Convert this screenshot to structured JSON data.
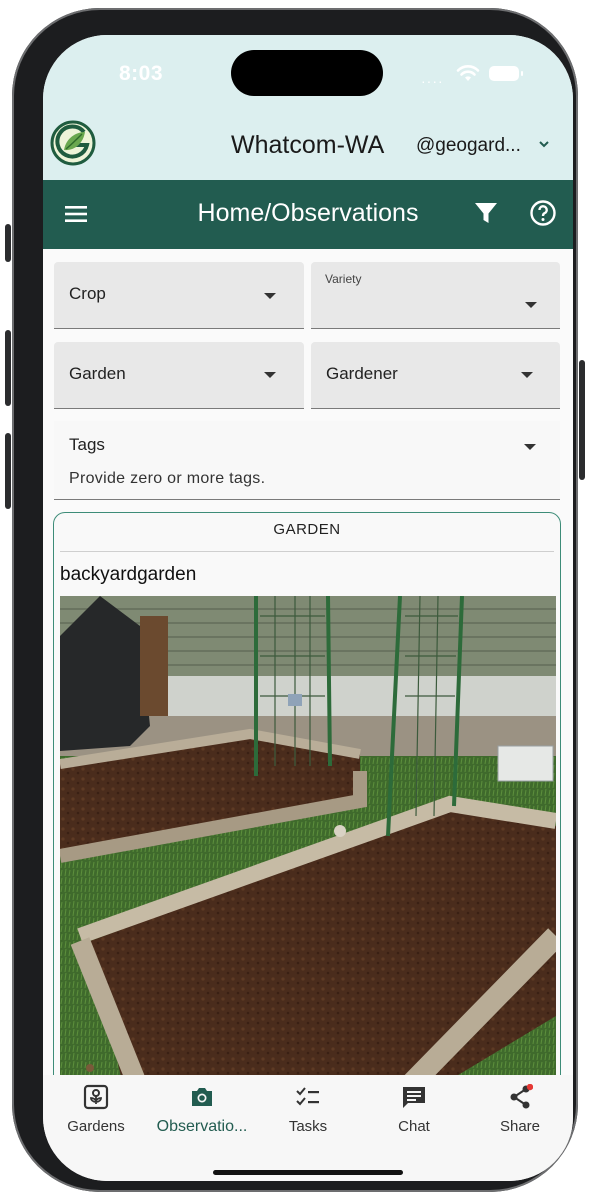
{
  "status": {
    "time": "8:03"
  },
  "header": {
    "region": "Whatcom-WA",
    "account": "@geogard..."
  },
  "appbar": {
    "title": "Home/Observations"
  },
  "filters": {
    "crop": "Crop",
    "variety": "Variety",
    "garden": "Garden",
    "gardener": "Gardener",
    "tags_label": "Tags",
    "tags_hint": "Provide zero or more tags."
  },
  "card": {
    "header": "GARDEN",
    "name": "backyardgarden"
  },
  "nav": {
    "items": [
      {
        "label": "Gardens",
        "icon": "garden-icon"
      },
      {
        "label": "Observatio...",
        "icon": "camera-icon"
      },
      {
        "label": "Tasks",
        "icon": "checklist-icon"
      },
      {
        "label": "Chat",
        "icon": "chat-icon"
      },
      {
        "label": "Share",
        "icon": "share-icon"
      }
    ],
    "active_index": 1
  },
  "colors": {
    "brand": "#225c50",
    "header_bg": "#dcefef",
    "card_border": "#3d8c78",
    "notification_dot": "#e53935"
  }
}
